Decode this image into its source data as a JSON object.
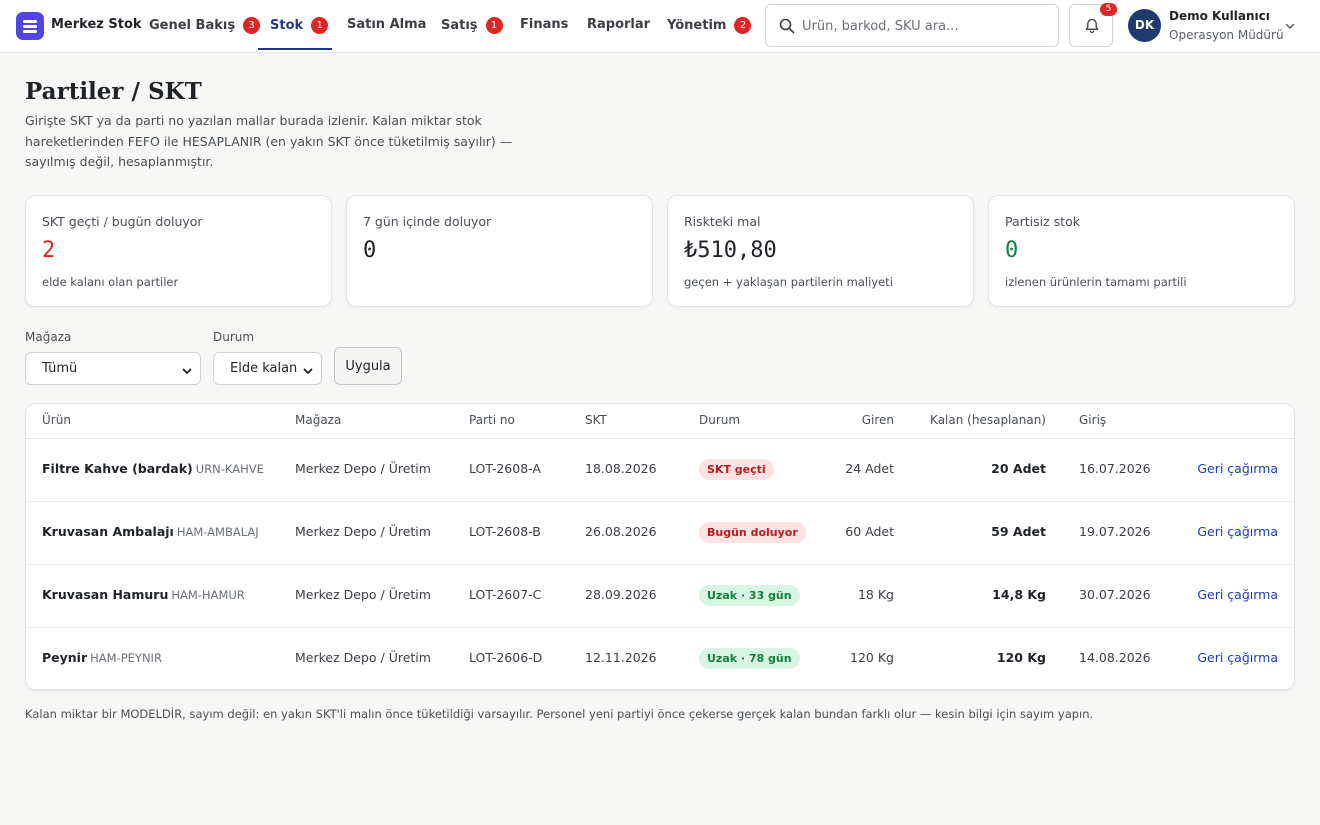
{
  "app": {
    "name": "Merkez Stok"
  },
  "nav": {
    "items": [
      {
        "label": "Genel Bakış",
        "badge": "3"
      },
      {
        "label": "Stok",
        "badge": "1"
      },
      {
        "label": "Satın Alma",
        "badge": ""
      },
      {
        "label": "Satış",
        "badge": "1"
      },
      {
        "label": "Finans",
        "badge": ""
      },
      {
        "label": "Raporlar",
        "badge": ""
      },
      {
        "label": "Yönetim",
        "badge": "2"
      }
    ],
    "active": "Stok"
  },
  "search": {
    "placeholder": "Ürün, barkod, SKU ara...",
    "value": ""
  },
  "notifications": {
    "count": "5"
  },
  "user": {
    "initials": "DK",
    "name": "Demo Kullanıcı",
    "role": "Operasyon Müdürü"
  },
  "page": {
    "title": "Partiler / SKT",
    "description": "Girişte SKT ya da parti no yazılan mallar burada izlenir. Kalan miktar stok hareketlerinden FEFO ile HESAPLANIR (en yakın SKT önce tüketilmiş sayılır) — sayılmış değil, hesaplanmıştır."
  },
  "cards": [
    {
      "label": "SKT geçti / bugün doluyor",
      "value": "2",
      "sub": "elde kalanı olan partiler",
      "tone": "red"
    },
    {
      "label": "7 gün içinde doluyor",
      "value": "0",
      "sub": "",
      "tone": "default"
    },
    {
      "label": "Riskteki mal",
      "value": "₺510,80",
      "sub": "geçen + yaklaşan partilerin maliyeti",
      "tone": "default"
    },
    {
      "label": "Partisiz stok",
      "value": "0",
      "sub": "izlenen ürünlerin tamamı partili",
      "tone": "green"
    }
  ],
  "filters": {
    "store_label": "Mağaza",
    "store_value": "Tümü",
    "status_label": "Durum",
    "status_value": "Elde kalan",
    "apply_label": "Uygula"
  },
  "table": {
    "headers": {
      "product": "Ürün",
      "store": "Mağaza",
      "lot": "Parti no",
      "skt": "SKT",
      "status": "Durum",
      "in": "Giren",
      "remaining": "Kalan (hesaplanan)",
      "entry": "Giriş"
    },
    "rows": [
      {
        "product": "Filtre Kahve (bardak)",
        "sku": "URN-KAHVE",
        "store": "Merkez Depo / Üretim",
        "lot": "LOT-2608-A",
        "skt": "18.08.2026",
        "status": "SKT geçti",
        "status_tone": "danger",
        "in": "24 Adet",
        "remaining": "20 Adet",
        "entry": "16.07.2026",
        "action": "Geri çağırma"
      },
      {
        "product": "Kruvasan Ambalajı",
        "sku": "HAM-AMBALAJ",
        "store": "Merkez Depo / Üretim",
        "lot": "LOT-2608-B",
        "skt": "26.08.2026",
        "status": "Bugün doluyor",
        "status_tone": "danger",
        "in": "60 Adet",
        "remaining": "59 Adet",
        "entry": "19.07.2026",
        "action": "Geri çağırma"
      },
      {
        "product": "Kruvasan Hamuru",
        "sku": "HAM-HAMUR",
        "store": "Merkez Depo / Üretim",
        "lot": "LOT-2607-C",
        "skt": "28.09.2026",
        "status": "Uzak · 33 gün",
        "status_tone": "ok",
        "in": "18 Kg",
        "remaining": "14,8 Kg",
        "entry": "30.07.2026",
        "action": "Geri çağırma"
      },
      {
        "product": "Peynir",
        "sku": "HAM-PEYNIR",
        "store": "Merkez Depo / Üretim",
        "lot": "LOT-2606-D",
        "skt": "12.11.2026",
        "status": "Uzak · 78 gün",
        "status_tone": "ok",
        "in": "120 Kg",
        "remaining": "120 Kg",
        "entry": "14.08.2026",
        "action": "Geri çağırma"
      }
    ]
  },
  "footnote": "Kalan miktar bir MODELDİR, sayım değil: en yakın SKT'li malın önce tüketildiği varsayılır. Personel yeni partiyi önce çekerse gerçek kalan bundan farklı olur — kesin bilgi için sayım yapın.",
  "colors": {
    "accent": "#1e3a8a",
    "danger": "#dc2626",
    "success": "#15803d",
    "logo": "#4f46e5"
  }
}
